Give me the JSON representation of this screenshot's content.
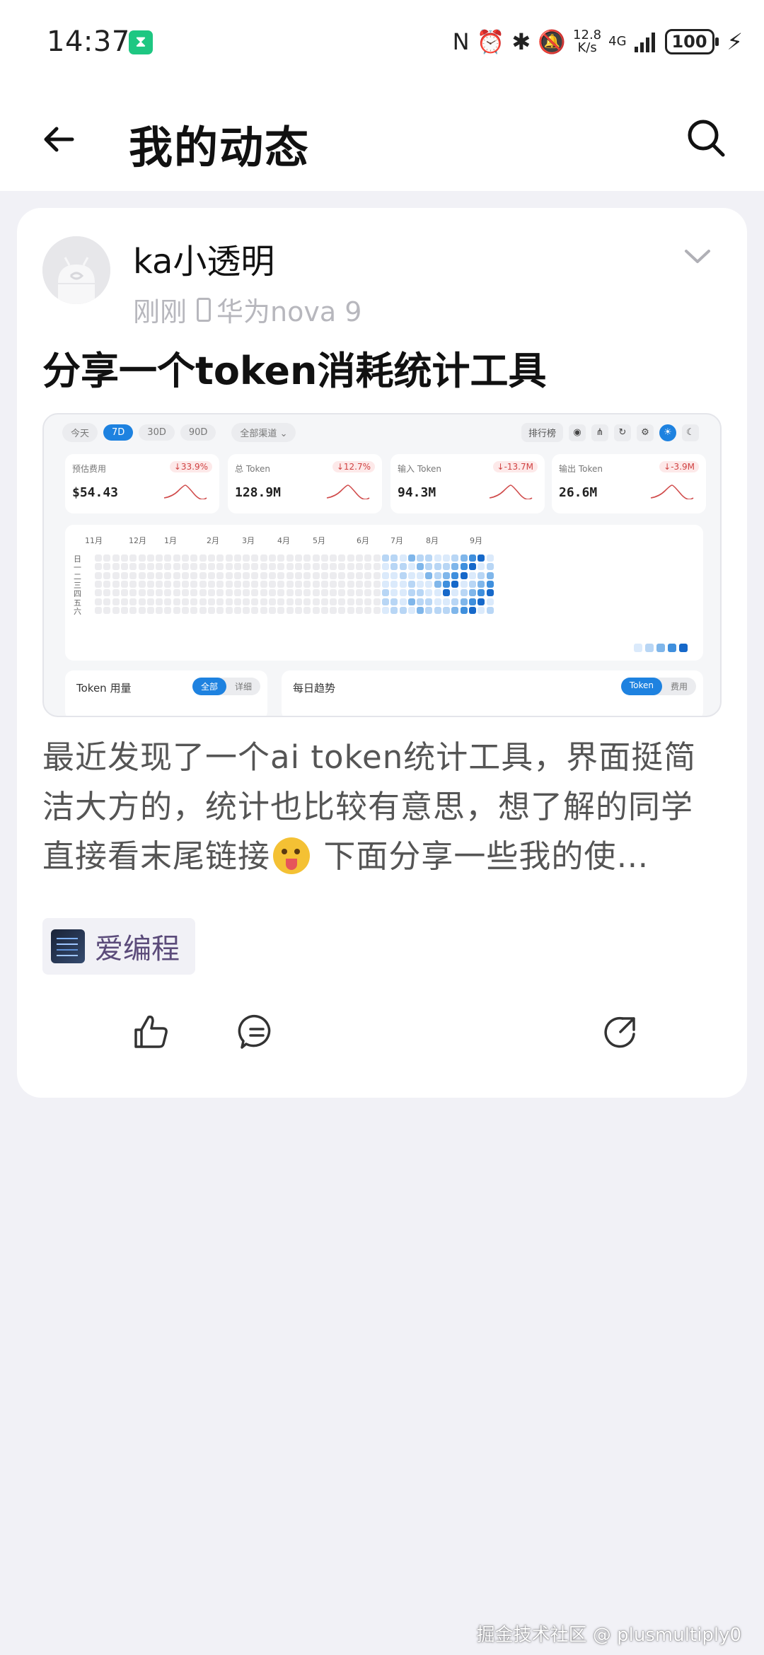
{
  "status_bar": {
    "time": "14:37",
    "speed_value": "12.8",
    "speed_unit": "K/s",
    "network": "4G",
    "battery": "100",
    "icons": [
      "hourglass-icon",
      "nfc-icon",
      "alarm-icon",
      "bluetooth-icon",
      "mute-icon",
      "signal-icon",
      "charging-icon"
    ]
  },
  "header": {
    "title": "我的动态"
  },
  "post": {
    "author": "ka小透明",
    "time": "刚刚",
    "device": "华为nova 9",
    "title": "分享一个token消耗统计工具",
    "body_part1": "最近发现了一个ai token统计工具，界面挺简洁大方的，统计也比较有意思，想了解的同学直接看末尾链接",
    "body_part2": " 下面分享一些我的使…",
    "tag": "爱编程"
  },
  "embedded_screenshot": {
    "range_tabs": [
      "今天",
      "7D",
      "30D",
      "90D"
    ],
    "active_tab": "7D",
    "channel_dropdown": "全部渠道",
    "leaderboard_button": "排行榜",
    "stats": [
      {
        "label": "预估费用",
        "value": "$54.43",
        "delta": "↓33.9%"
      },
      {
        "label": "总 Token",
        "value": "128.9M",
        "delta": "↓12.7%"
      },
      {
        "label": "输入 Token",
        "value": "94.3M",
        "delta": "↓-13.7M"
      },
      {
        "label": "输出 Token",
        "value": "26.6M",
        "delta": "↓-3.9M"
      }
    ],
    "heatmap_months": [
      "11月",
      "12月",
      "1月",
      "2月",
      "3月",
      "4月",
      "5月",
      "6月",
      "7月",
      "8月",
      "9月"
    ],
    "heatmap_days": [
      "日",
      "一",
      "二",
      "三",
      "四",
      "五",
      "六"
    ],
    "panel_left": {
      "title": "Token 用量",
      "seg_on": "全部",
      "seg_off": "详细"
    },
    "panel_right": {
      "title": "每日趋势",
      "seg_on": "Token",
      "seg_off": "费用"
    }
  },
  "watermark": "掘金技术社区 @ plusmultiply0",
  "colors": {
    "accent_blue": "#1e82e0",
    "heat_levels": [
      "#ececef",
      "#dbeafb",
      "#b8d6f5",
      "#7fb6ea",
      "#3f8fdd",
      "#1668c9"
    ]
  }
}
